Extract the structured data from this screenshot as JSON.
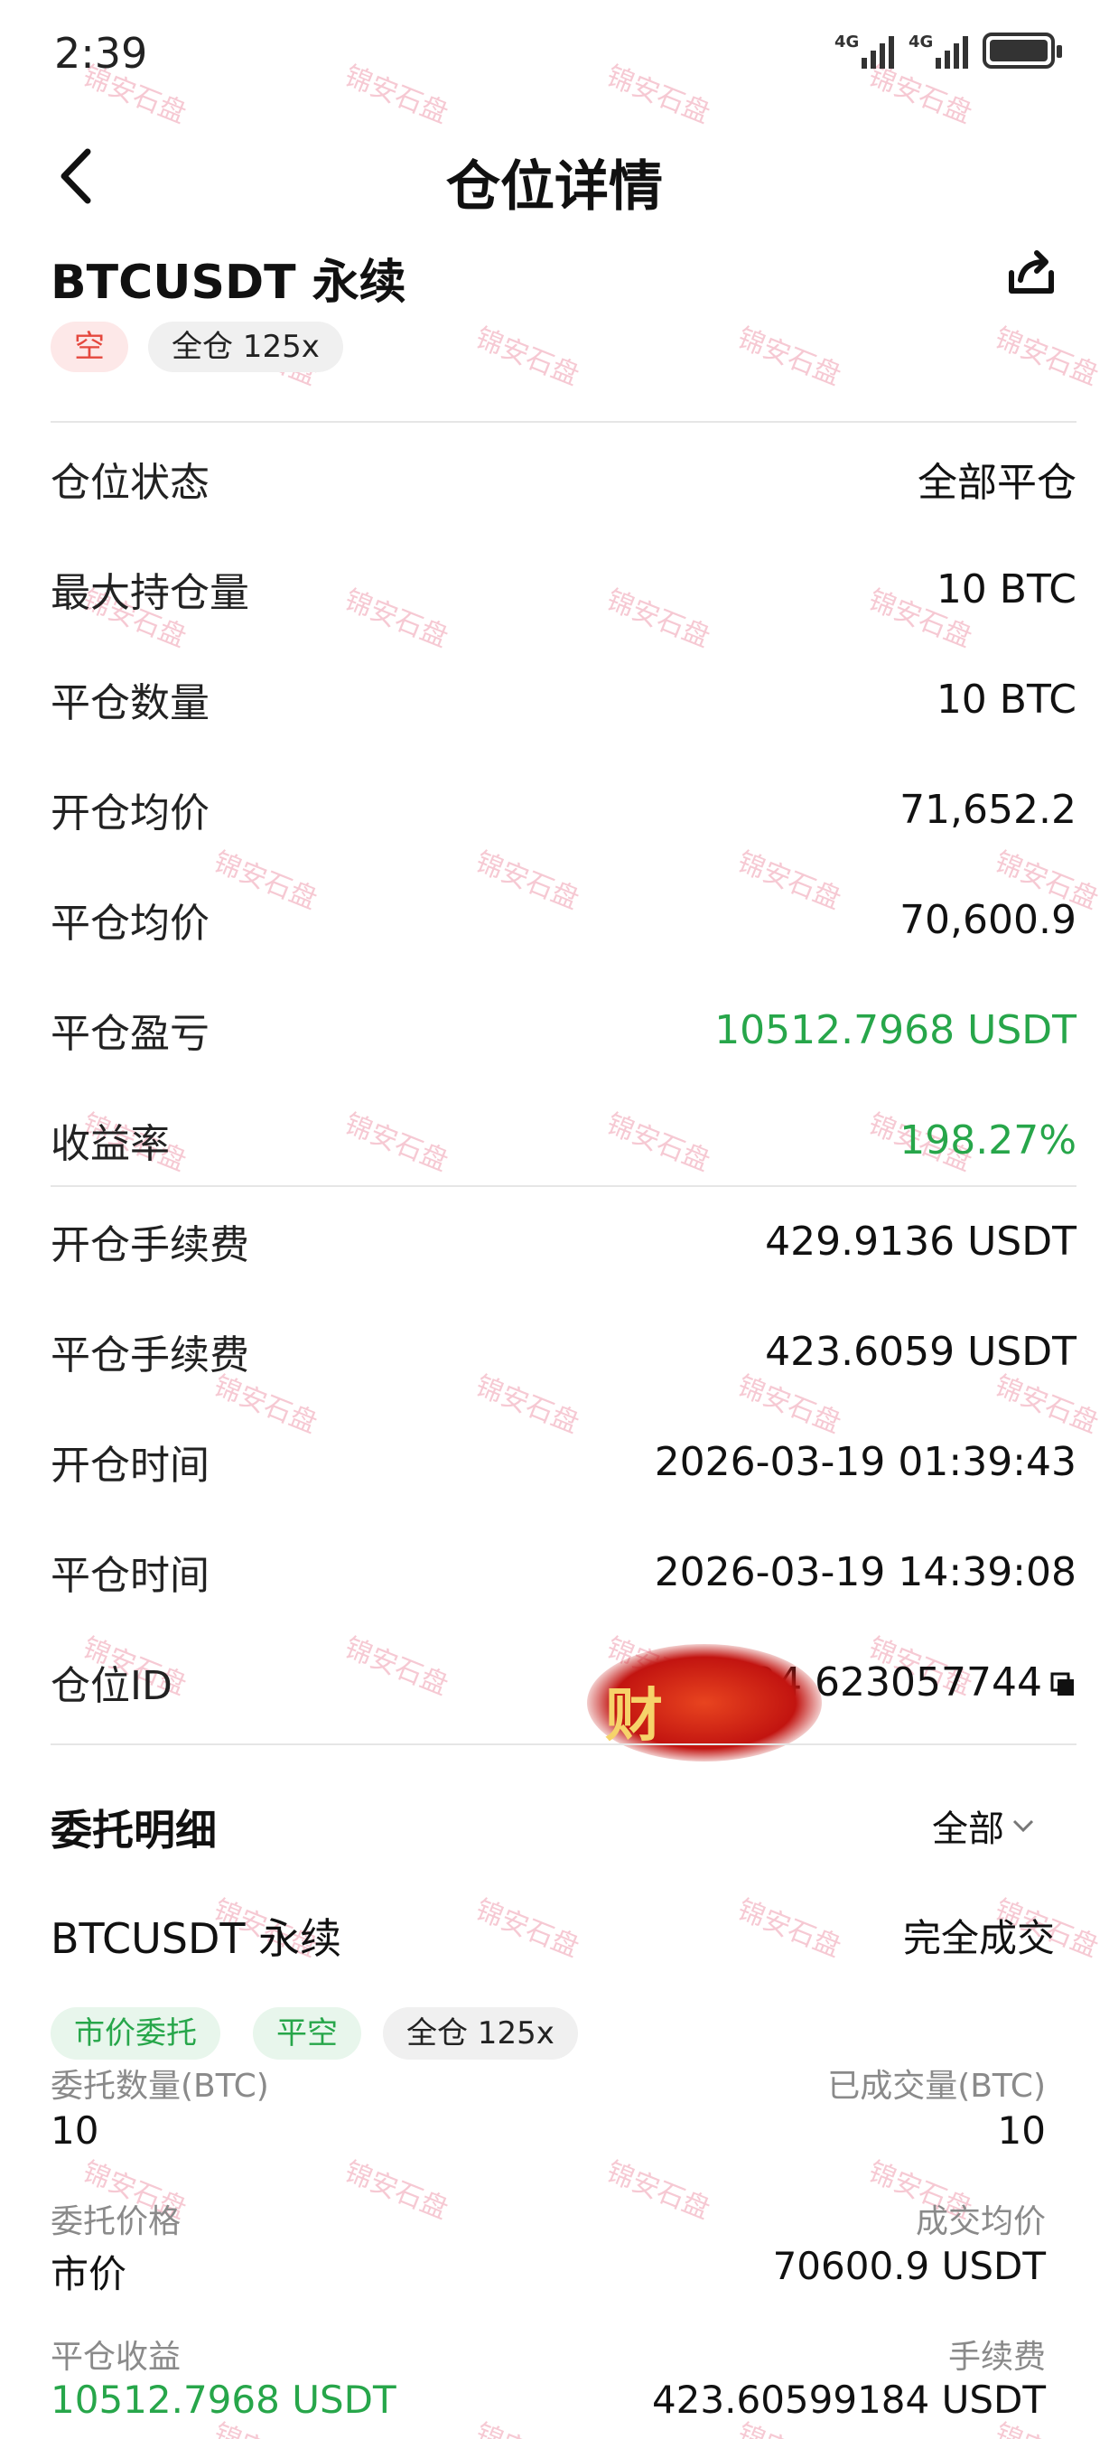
{
  "status_bar": {
    "time": "2:39",
    "signal1": "4G",
    "signal2": "4G"
  },
  "nav": {
    "title": "仓位详情"
  },
  "position": {
    "symbol": "BTCUSDT 永续",
    "side_tag": "空",
    "margin_tag": "全仓 125x",
    "rows": [
      {
        "label": "仓位状态",
        "value": "全部平仓"
      },
      {
        "label": "最大持仓量",
        "value": "10 BTC"
      },
      {
        "label": "平仓数量",
        "value": "10 BTC"
      },
      {
        "label": "开仓均价",
        "value": "71,652.2"
      },
      {
        "label": "平仓均价",
        "value": "70,600.9"
      },
      {
        "label": "平仓盈亏",
        "value": "10512.7968 USDT"
      },
      {
        "label": "收益率",
        "value": "198.27%"
      },
      {
        "label": "开仓手续费",
        "value": "429.9136 USDT"
      },
      {
        "label": "平仓手续费",
        "value": "423.6059 USDT"
      },
      {
        "label": "开仓时间",
        "value": "2026-03-19 01:39:43"
      },
      {
        "label": "平仓时间",
        "value": "2026-03-19 14:39:08"
      },
      {
        "label": "仓位ID",
        "value": "24 623057744"
      }
    ],
    "sticker_text": "财"
  },
  "orders": {
    "title": "委托明细",
    "filter": "全部",
    "item": {
      "name": "BTCUSDT 永续",
      "status": "完全成交",
      "tags": [
        "市价委托",
        "平空",
        "全仓 125x"
      ],
      "fields": {
        "qty_label": "委托数量(BTC)",
        "qty_value": "10",
        "filled_label": "已成交量(BTC)",
        "filled_value": "10",
        "price_label": "委托价格",
        "price_value": "市价",
        "avg_label": "成交均价",
        "avg_value": "70600.9 USDT",
        "pnl_label": "平仓收益",
        "pnl_value": "10512.7968 USDT",
        "fee_label": "手续费",
        "fee_value": "423.60599184 USDT"
      }
    }
  },
  "watermark": "锦安石盘",
  "colors": {
    "profit": "#27a64a",
    "short": "#e5483e"
  }
}
